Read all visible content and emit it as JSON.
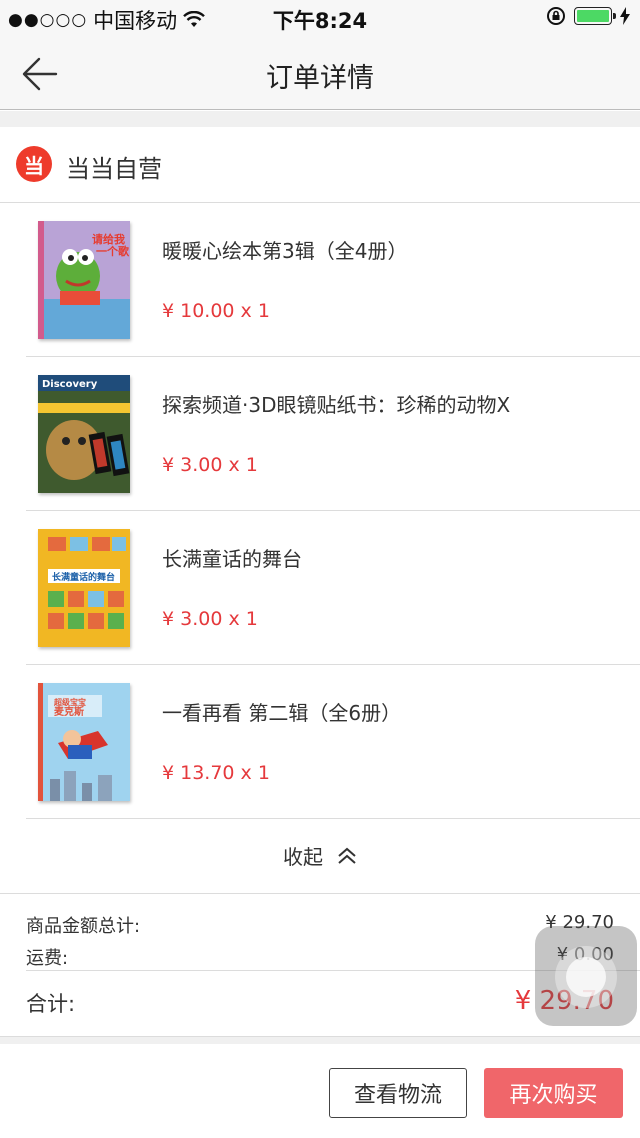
{
  "status_bar": {
    "signal_dots": "●●○○○",
    "carrier": "中国移动",
    "wifi_icon": "wifi-icon",
    "time": "下午8:24",
    "lock_icon": "rotation-lock-icon",
    "battery_icon": "battery-icon",
    "charging_icon": "charging-bolt-icon"
  },
  "nav": {
    "back_icon": "back-arrow-icon",
    "title": "订单详情"
  },
  "shop": {
    "logo_text": "当",
    "name": "当当自营",
    "logo_color": "#ee3b2b"
  },
  "items": [
    {
      "title": "暖暖心绘本第3辑（全4册）",
      "price": "¥ 10.00 x 1",
      "cover_text": "请给我唱一个歌"
    },
    {
      "title": "探索频道·3D眼镜贴纸书：珍稀的动物X",
      "price": "¥ 3.00 x 1",
      "cover_text": "Discovery"
    },
    {
      "title": "长满童话的舞台",
      "price": "¥ 3.00 x 1",
      "cover_text": "长满童话的舞台"
    },
    {
      "title": "一看再看 第二辑（全6册）",
      "price": "¥ 13.70 x 1",
      "cover_text": "麦克斯"
    }
  ],
  "collapse": {
    "label": "收起",
    "icon": "double-chevron-up-icon"
  },
  "summary": {
    "goods_label": "商品金额总计:",
    "goods_value": "¥ 29.70",
    "shipping_label": "运费:",
    "shipping_value": "¥ 0.00",
    "total_label": "合计:",
    "total_value": "¥ 29.70"
  },
  "actions": {
    "logistics_label": "查看物流",
    "rebuy_label": "再次购买"
  },
  "colors": {
    "price_red": "#e5393c",
    "rebuy_button": "#f0666a",
    "battery_green": "#4cd964"
  }
}
